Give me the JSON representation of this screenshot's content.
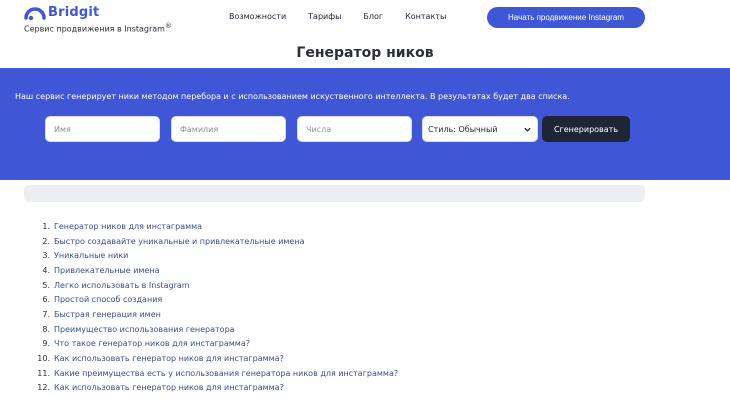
{
  "header": {
    "logo_name": "Bridgit",
    "logo_tagline": "Сервис продвижения в Instagram",
    "logo_mark_icon": "half-ring-logo-icon",
    "nav": [
      "Возможности",
      "Тарифы",
      "Блог",
      "Контакты"
    ],
    "cta_label": "Начать продвижение Instagram"
  },
  "page_title": "Генератор ников",
  "generator": {
    "description": "Наш сервис генерирует ники методом перебора и с использованием искуственного интеллекта. В результатах будет два списка.",
    "first_name_placeholder": "Имя",
    "last_name_placeholder": "Фамилия",
    "numbers_placeholder": "Числа",
    "style_value": "Стиль: Обычный",
    "generate_label": "Сгенерировать"
  },
  "toc": [
    {
      "num": "1.",
      "text": "Генератор ников для инстаграмма"
    },
    {
      "num": "2.",
      "text": "Быстро создавайте уникальные и привлекательные имена"
    },
    {
      "num": "3.",
      "text": "Уникальные ники"
    },
    {
      "num": "4.",
      "text": "Привлекательные имена"
    },
    {
      "num": "5.",
      "text": "Легко использовать в Instagram"
    },
    {
      "num": "6.",
      "text": "Простой способ создания"
    },
    {
      "num": "7.",
      "text": "Быстрая генерация имен"
    },
    {
      "num": "8.",
      "text": "Преимущество использования генератора"
    },
    {
      "num": "9.",
      "text": "Что такое генератор ников для инстаграмма?"
    },
    {
      "num": "10.",
      "text": "Как использовать генератор ников для инстаграмма?"
    },
    {
      "num": "11.",
      "text": "Какие преимущества есть у использования генератора ников для инстаграмма?"
    },
    {
      "num": "12.",
      "text": "Как использовать генератор ников для инстаграмма?"
    }
  ],
  "colors": {
    "accent": "#3f57d6",
    "button_dark": "#1e2636",
    "link": "#3a4f8c"
  }
}
